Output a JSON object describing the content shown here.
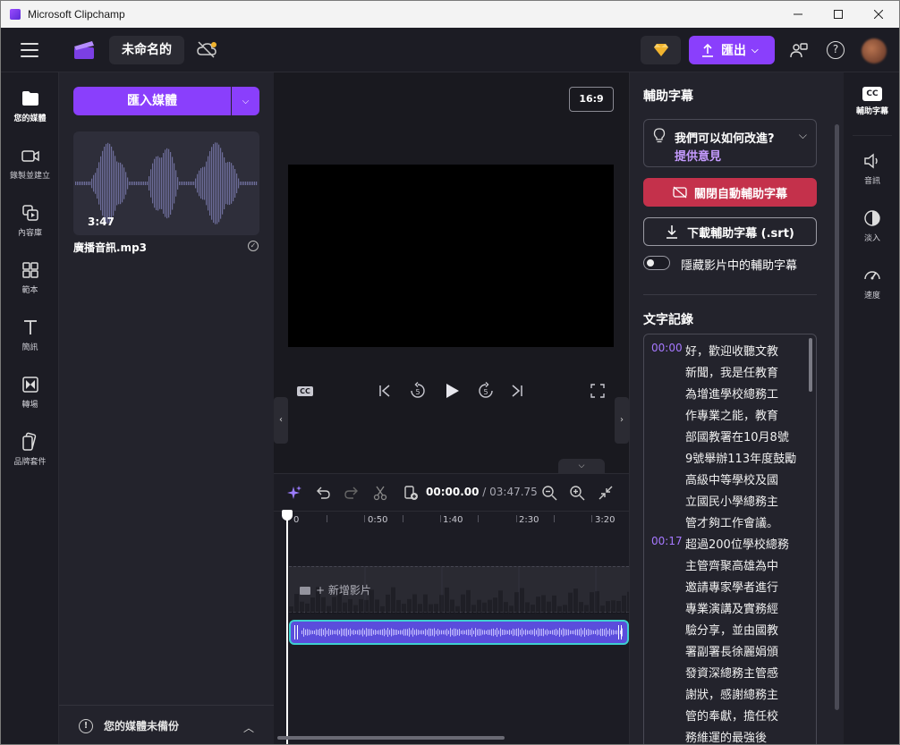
{
  "window": {
    "title": "Microsoft Clipchamp",
    "controls": {
      "minimize": "─",
      "maximize": "☐",
      "close": "✕"
    }
  },
  "topbar": {
    "project_name": "未命名的",
    "export_label": "匯出",
    "help_label": "?"
  },
  "leftnav": {
    "items": [
      {
        "label": "您的媒體",
        "icon": "folder-icon",
        "active": true
      },
      {
        "label": "錄製並建立",
        "icon": "camera-icon"
      },
      {
        "label": "內容庫",
        "icon": "library-icon"
      },
      {
        "label": "範本",
        "icon": "templates-icon"
      },
      {
        "label": "簡訊",
        "icon": "text-icon"
      },
      {
        "label": "轉場",
        "icon": "transitions-icon"
      },
      {
        "label": "品牌套件",
        "icon": "brand-kit-icon"
      }
    ]
  },
  "media": {
    "import_label": "匯入媒體",
    "item": {
      "duration": "3:47",
      "name": "廣播音訊.mp3"
    },
    "backup_label": "您的媒體未備份"
  },
  "preview": {
    "aspect_ratio": "16:9",
    "cc_label": "CC",
    "skip_back_seconds": "5",
    "skip_forward_seconds": "5"
  },
  "timeline": {
    "current_time": "00:00.00",
    "total_time": " / 03:47.75",
    "ruler": [
      "0",
      "0:50",
      "1:40",
      "2:30",
      "3:20"
    ],
    "add_video_label": "+ 新增影片"
  },
  "captions": {
    "title": "輔助字幕",
    "feedback_question": "我們可以如何改進?",
    "feedback_link": "提供意見",
    "turn_off_label": "關閉自動輔助字幕",
    "download_label": "下載輔助字幕 (.srt)",
    "hide_label": "隱藏影片中的輔助字幕",
    "hide_enabled": false,
    "transcript_title": "文字記錄",
    "segments": [
      {
        "time": "00:00",
        "lines": [
          "好，歡迎收聽文教",
          "新聞，我是任教育",
          "為增進學校總務工",
          "作專業之能，教育",
          "部國教署在10月8號",
          "9號舉辦113年度鼓勵",
          "高級中等學校及國",
          "立國民小學總務主",
          "管才夠工作會議。"
        ]
      },
      {
        "time": "00:17",
        "lines": [
          "超過200位學校總務",
          "主管齊聚高雄為中",
          "邀請專家學者進行",
          "專業演講及實務經",
          "驗分享，並由國教",
          "署副署長徐麗娟頒",
          "發資深總務主管感",
          "謝狀，感謝總務主",
          "管的奉獻，擔任校",
          "務維運的最強後"
        ]
      }
    ]
  },
  "rightnav": {
    "items": [
      {
        "label": "輔助字幕",
        "badge": "CC",
        "active": true
      },
      {
        "label": "音訊",
        "icon": "speaker-icon"
      },
      {
        "label": "淡入",
        "icon": "fade-icon"
      },
      {
        "label": "速度",
        "icon": "speed-icon"
      }
    ]
  },
  "colors": {
    "accent": "#8a3ffc",
    "danger": "#c4314b",
    "audio_clip": "#5b4ddc",
    "audio_border": "#3ed0cf",
    "timestamp": "#a678ff"
  }
}
